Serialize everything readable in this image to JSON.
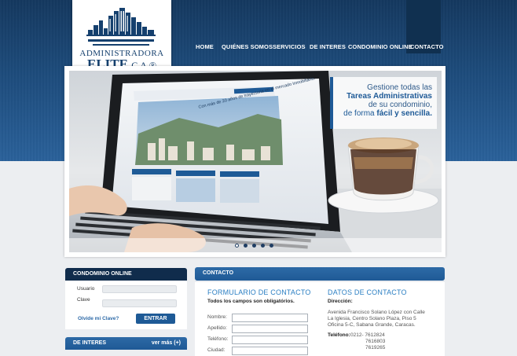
{
  "logo": {
    "line1": "ADMINISTRADORA",
    "line2": "ELITE",
    "suffix": "C.A.®",
    "icon": "city-skyline-icon"
  },
  "nav": {
    "items": [
      "HOME",
      "QUIÉNES SOMOS",
      "SERVICIOS",
      "DE INTERES",
      "CONDOMINIO ONLINE",
      "CONTACTO"
    ],
    "active": "CONTACTO"
  },
  "slider": {
    "caption_line1": "Gestione todas las",
    "caption_line2": "Tareas Administrativas",
    "caption_line3": "de su condominio,",
    "caption_line4_a": "de forma ",
    "caption_line4_b": "fácil y sencilla.",
    "screen_text": "Con más de 20 años de trayectoria en el mercado inmobiliario.",
    "dots": 5,
    "active_dot": 1
  },
  "condominio_online": {
    "title": "CONDOMINIO ONLINE",
    "usuario_label": "Usuario",
    "clave_label": "Clave",
    "forgot_link": "Olvide mi Clave?",
    "submit_label": "ENTRAR"
  },
  "de_interes": {
    "title": "DE INTERES",
    "more_link": "ver más (+)"
  },
  "contacto": {
    "title": "CONTACTO",
    "form_heading": "FORMULARIO DE CONTACTO",
    "required_note": "Todos los campos son obligatórios.",
    "fields": [
      "Nombre:",
      "Apellido:",
      "Teléfono:",
      "Ciudad:"
    ],
    "datos_heading": "DATOS DE CONTACTO",
    "direccion_label": "Dirección:",
    "direccion_text": [
      "Avenida Francisco Solano López con Calle",
      "La Iglesia, Centro Solano Plaza, Piso 5",
      "Oficina 5-C, Sabana Grande, Caracas."
    ],
    "telefono_label": "Teléfono:",
    "telefonos": [
      "0212- 7612824",
      "7616803",
      "7619265"
    ]
  },
  "colors": {
    "brand_dark": "#102c4c",
    "brand_blue": "#1e5a96",
    "accent_text": "#2b7fc3"
  }
}
